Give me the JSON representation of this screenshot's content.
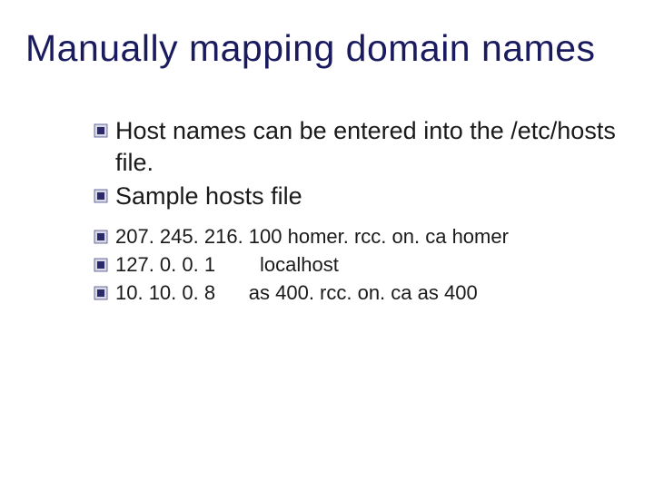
{
  "title": "Manually mapping domain names",
  "bullets": {
    "b1": "Host names can be entered into the /etc/hosts file.",
    "b2": "Sample hosts file",
    "b3": "207. 245. 216. 100 homer. rcc. on. ca homer",
    "b4": "127. 0. 0. 1        localhost",
    "b5": "10. 10. 0. 8      as 400. rcc. on. ca as 400"
  }
}
